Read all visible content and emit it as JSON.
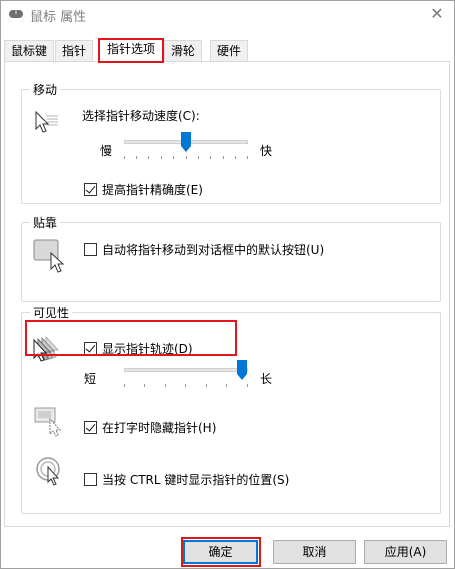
{
  "window": {
    "title": "鼠标 属性",
    "close_glyph": "✕"
  },
  "tabs": [
    {
      "label": "鼠标键"
    },
    {
      "label": "指针"
    },
    {
      "label": "指针选项"
    },
    {
      "label": "滑轮"
    },
    {
      "label": "硬件"
    }
  ],
  "motion": {
    "group_label": "移动",
    "speed_label": "选择指针移动速度(C):",
    "slow_label": "慢",
    "fast_label": "快",
    "speed_value_fraction": 0.5,
    "precision_label": "提高指针精确度(E)",
    "precision_checked": true
  },
  "snap": {
    "group_label": "贴靠",
    "snap_label": "自动将指针移动到对话框中的默认按钮(U)",
    "snap_checked": false
  },
  "visibility": {
    "group_label": "可见性",
    "trails_label": "显示指针轨迹(D)",
    "trails_checked": true,
    "short_label": "短",
    "long_label": "长",
    "trails_value_fraction": 1.0,
    "hide_label": "在打字时隐藏指针(H)",
    "hide_checked": true,
    "ctrl_label": "当按 CTRL 键时显示指针的位置(S)",
    "ctrl_checked": false
  },
  "buttons": {
    "ok": "确定",
    "cancel": "取消",
    "apply": "应用(A)"
  },
  "colors": {
    "accent": "#0078d7",
    "highlight": "#e0161b"
  }
}
